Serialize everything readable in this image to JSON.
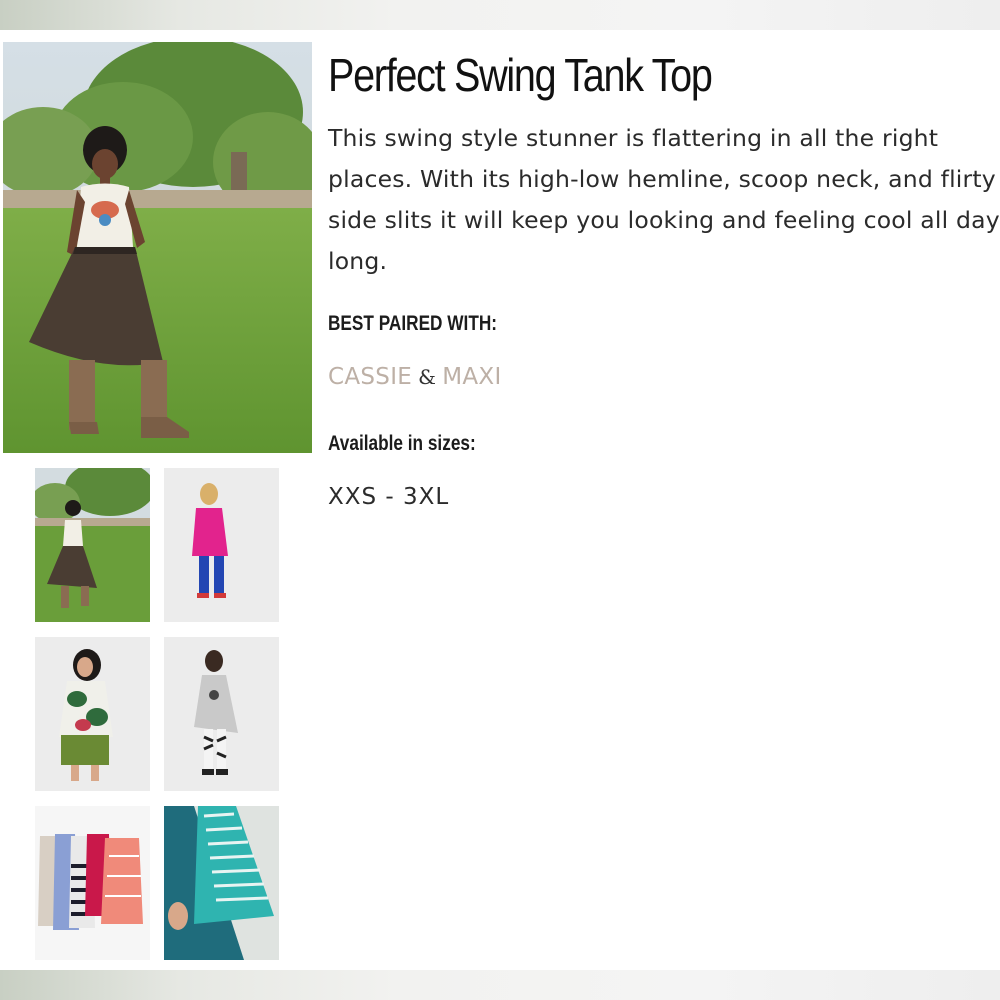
{
  "product": {
    "title": "Perfect Swing Tank Top",
    "description": "This swing style stunner is flattering in all the right places. With its high-low hemline, scoop neck, and flirty side slits it will keep you looking and feeling cool all day long.",
    "paired_label": "BEST PAIRED WITH:",
    "paired_items": [
      "CASSIE",
      "MAXI"
    ],
    "paired_separator": "&",
    "sizes_label": "Available in sizes:",
    "sizes_value": "XXS - 3XL"
  },
  "gallery": {
    "main_photo": "model-outdoor-white-tank-pleated-skirt",
    "thumbnails": [
      "thumb-outdoor-white-tank",
      "thumb-pink-tank-blue-leggings",
      "thumb-floral-tank-green-skirt",
      "thumb-grey-tank-print-leggings",
      "thumb-tanks-on-hangers",
      "thumb-teal-stripe-slit-detail"
    ]
  },
  "colors": {
    "title": "#111111",
    "body_text": "#2b2b2b",
    "link_muted": "#bdb0a6"
  }
}
